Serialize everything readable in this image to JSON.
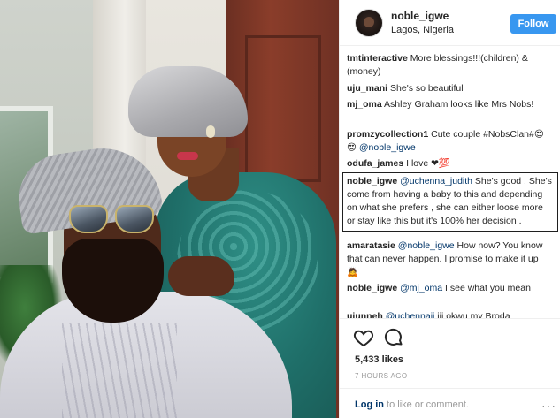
{
  "header": {
    "username": "noble_igwe",
    "location": "Lagos, Nigeria",
    "follow_label": "Follow"
  },
  "comments": [
    {
      "user": "tmtinteractive",
      "text": "More blessings!!!(children) & (money)",
      "mention": ""
    },
    {
      "user": "uju_mani",
      "text": "She's so beautiful",
      "mention": ""
    },
    {
      "user": "mj_oma",
      "text": "Ashley Graham looks like Mrs Nobs!",
      "mention": ""
    },
    {
      "user": "promzycollection1",
      "text": "Cute couple #NobsClan#😍😍",
      "mention": "@noble_igwe"
    },
    {
      "user": "odufa_james",
      "text": "I love ❤💯",
      "mention": ""
    },
    {
      "user": "noble_igwe",
      "mention": "@uchenna_judith",
      "text": "She's good . She's come from having a baby to this and depending on what she prefers , she can either loose more or stay like this but it's 100% her decision ."
    },
    {
      "user": "amaratasie",
      "mention": "@noble_igwe",
      "text": "How now? You know that can never happen. I promise to make it up 🙇"
    },
    {
      "user": "noble_igwe",
      "mention": "@mj_oma",
      "text": "I see what you mean"
    },
    {
      "user": "uiunneh",
      "mention": "@uchennaii",
      "text": "iii okwu my Broda"
    }
  ],
  "actions": {
    "like_icon": "heart-icon",
    "comment_icon": "comment-bubble-icon",
    "likes": "5,433 likes",
    "time": "7 HOURS AGO",
    "login_link": "Log in",
    "login_rest": " to like or comment.",
    "more": "···"
  },
  "colors": {
    "accent": "#3897f0",
    "link": "#003569",
    "muted": "#999999"
  }
}
